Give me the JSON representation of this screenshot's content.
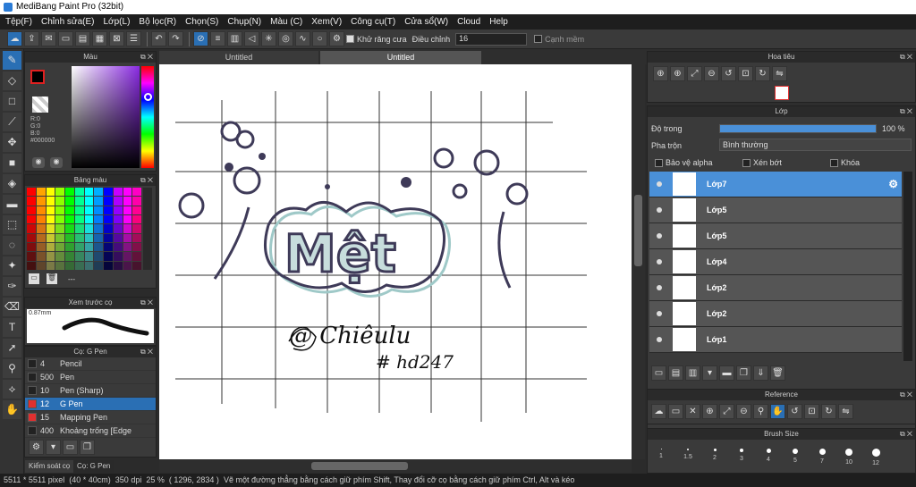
{
  "window": {
    "title": "MediBang Paint Pro (32bit)"
  },
  "menu": [
    "Tệp(F)",
    "Chỉnh sửa(E)",
    "Lớp(L)",
    "Bộ lọc(R)",
    "Chọn(S)",
    "Chụp(N)",
    "Màu (C)",
    "Xem(V)",
    "Công cụ(T)",
    "Cửa sổ(W)",
    "Cloud",
    "Help"
  ],
  "toolbar": {
    "antialias_label": "Khử răng cưa",
    "adjust_label": "Điều chỉnh",
    "adjust_value": "16",
    "edge_label": "Cạnh mềm"
  },
  "color_panel": {
    "title": "Màu",
    "r": "R:0",
    "g": "G:0",
    "b": "B:0",
    "hex": "#000000"
  },
  "swatch_panel": {
    "title": "Bảng màu",
    "footer": "---"
  },
  "brush_preview": {
    "title": "Xem trước cọ",
    "size": "0.87mm"
  },
  "brush_panel": {
    "title": "Cọ: G Pen",
    "brushes": [
      {
        "size": "4",
        "name": "Pencil",
        "color": "#222"
      },
      {
        "size": "500",
        "name": "Pen",
        "color": "#222"
      },
      {
        "size": "10",
        "name": "Pen (Sharp)",
        "color": "#222"
      },
      {
        "size": "12",
        "name": "G Pen",
        "color": "#e03030"
      },
      {
        "size": "15",
        "name": "Mapping Pen",
        "color": "#e03030"
      },
      {
        "size": "400",
        "name": "Khoảng trống [Edge",
        "color": "#222"
      }
    ],
    "tab1": "Kiểm soát cọ",
    "tab2": "Cọ: G Pen"
  },
  "tabs": [
    "Untitled",
    "Untitled"
  ],
  "canvas": {
    "text_main": "Mệt",
    "signature": "@ Chiêulu",
    "hashtag": "# hd247"
  },
  "navigator": {
    "title": "Hoa tiêu"
  },
  "layer_panel": {
    "title": "Lớp",
    "opacity_label": "Độ trong",
    "opacity_value": "100 %",
    "opacity_fraction": 1.0,
    "blend_label": "Pha trộn",
    "blend_value": "Bình thường",
    "protect_alpha": "Bảo vệ alpha",
    "clip": "Xén bớt",
    "lock": "Khóa",
    "layers": [
      "Lớp7",
      "Lớp5",
      "Lớp5",
      "Lớp4",
      "Lớp2",
      "Lớp2",
      "Lớp1"
    ]
  },
  "reference": {
    "title": "Reference"
  },
  "brush_size": {
    "title": "Brush Size",
    "sizes": [
      "1",
      "1.5",
      "2",
      "3",
      "4",
      "5",
      "7",
      "10",
      "12"
    ]
  },
  "status": {
    "dims": "5511 * 5511 pixel",
    "cm": "(40 * 40cm)",
    "dpi": "350 dpi",
    "zoom": "25 %",
    "coords": "( 1296, 2834 )",
    "hint": "Vẽ một đường thẳng bằng cách giữ phím Shift, Thay đổi cỡ cọ bằng cách giữ phím Ctrl, Alt và kéo"
  }
}
